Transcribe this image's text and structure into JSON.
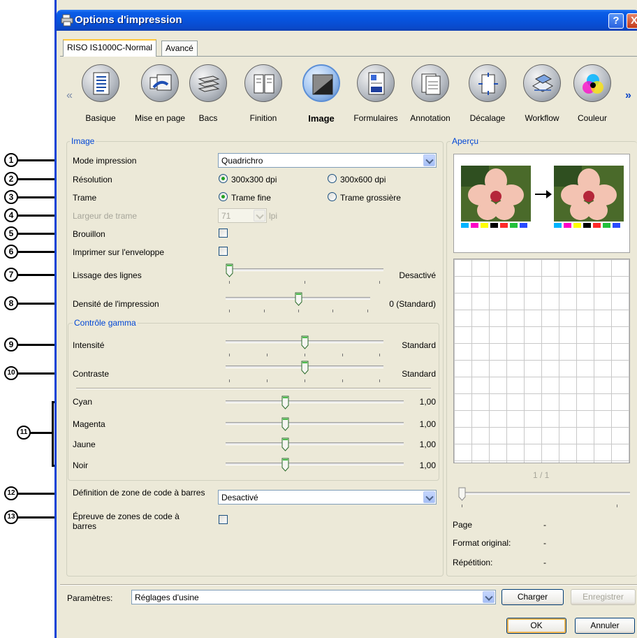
{
  "window": {
    "title": "Options d'impression",
    "help_label": "?",
    "close_label": "X"
  },
  "tabs": [
    {
      "label": "RISO IS1000C-Normal",
      "active": true
    },
    {
      "label": "Avancé",
      "active": false
    }
  ],
  "toolbar": {
    "left_arrow": "«",
    "right_arrow": "»",
    "items": [
      {
        "label": "Basique",
        "icon": "document-icon"
      },
      {
        "label": "Mise en page",
        "icon": "layout-icon"
      },
      {
        "label": "Bacs",
        "icon": "trays-icon"
      },
      {
        "label": "Finition",
        "icon": "finishing-icon"
      },
      {
        "label": "Image",
        "icon": "image-icon",
        "selected": true
      },
      {
        "label": "Formulaires",
        "icon": "forms-icon"
      },
      {
        "label": "Annotation",
        "icon": "annotation-icon"
      },
      {
        "label": "Décalage",
        "icon": "offset-icon"
      },
      {
        "label": "Workflow",
        "icon": "workflow-icon"
      },
      {
        "label": "Couleur",
        "icon": "color-icon"
      }
    ]
  },
  "image_group": {
    "title": "Image",
    "mode_label": "Mode impression",
    "mode_value": "Quadrichro",
    "resolution_label": "Résolution",
    "resolution_opt1": "300x300 dpi",
    "resolution_opt2": "300x600 dpi",
    "trame_label": "Trame",
    "trame_opt1": "Trame fine",
    "trame_opt2": "Trame grossière",
    "largeur_label": "Largeur de trame",
    "largeur_value": "71",
    "largeur_unit": "lpi",
    "brouillon_label": "Brouillon",
    "enveloppe_label": "Imprimer sur l'enveloppe",
    "lissage_label": "Lissage des lignes",
    "lissage_value": "Desactivé",
    "densite_label": "Densité de l'impression",
    "densite_value": "0 (Standard)"
  },
  "gamma_group": {
    "title": "Contrôle gamma",
    "intensite_label": "Intensité",
    "intensite_value": "Standard",
    "contraste_label": "Contraste",
    "contraste_value": "Standard",
    "cyan_label": "Cyan",
    "cyan_value": "1,00",
    "magenta_label": "Magenta",
    "magenta_value": "1,00",
    "jaune_label": "Jaune",
    "jaune_value": "1,00",
    "noir_label": "Noir",
    "noir_value": "1,00"
  },
  "barcode": {
    "zone_label": "Définition de zone de code à barres",
    "zone_value": "Desactivé",
    "epreuve_label": "Épreuve de zones de code à barres"
  },
  "callouts": [
    "1",
    "2",
    "3",
    "4",
    "5",
    "6",
    "7",
    "8",
    "9",
    "10",
    "11",
    "12",
    "13"
  ],
  "apercu": {
    "title": "Aperçu",
    "page_counter": "1 / 1",
    "page_label": "Page",
    "page_value": "-",
    "format_label": "Format original:",
    "format_value": "-",
    "repetition_label": "Répétition:",
    "repetition_value": "-",
    "swatch_colors": [
      "#00b4ff",
      "#ff00c8",
      "#ffff00",
      "#000000",
      "#ff2a2a",
      "#23c13a",
      "#2a4bff"
    ]
  },
  "footer": {
    "params_label": "Paramètres:",
    "params_value": "Réglages d'usine",
    "charger": "Charger",
    "enregistrer": "Enregistrer",
    "ok": "OK",
    "annuler": "Annuler"
  }
}
